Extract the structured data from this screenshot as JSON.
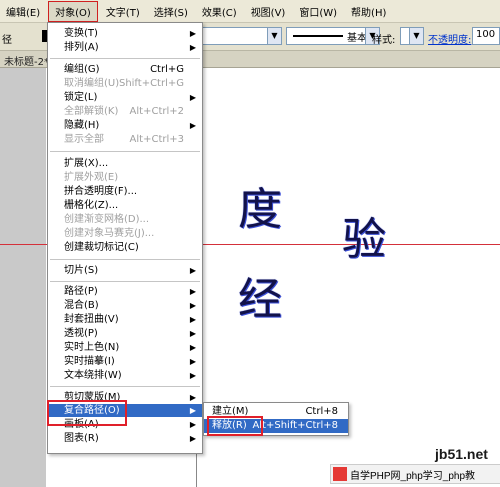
{
  "menubar": {
    "items": [
      "编辑(E)",
      "对象(O)",
      "文字(T)",
      "选择(S)",
      "效果(C)",
      "视图(V)",
      "窗口(W)",
      "帮助(H)"
    ]
  },
  "control_bar": {
    "left_label": "径",
    "stroke_style": "基本",
    "style_label": "样式:",
    "opacity_label": "不透明度:",
    "opacity_value": "100"
  },
  "document_tab": {
    "title": "未标题-2*"
  },
  "canvas": {
    "glyph_du": "度",
    "glyph_yan": "验",
    "glyph_jing": "经"
  },
  "object_menu": {
    "items": [
      {
        "label": "变换(T)",
        "submenu": true
      },
      {
        "label": "排列(A)",
        "submenu": true
      },
      {
        "label": "编组(G)",
        "shortcut": "Ctrl+G"
      },
      {
        "label": "取消编组(U)",
        "shortcut": "Shift+Ctrl+G",
        "disabled": true
      },
      {
        "label": "锁定(L)",
        "submenu": true
      },
      {
        "label": "全部解锁(K)",
        "shortcut": "Alt+Ctrl+2",
        "disabled": true
      },
      {
        "label": "隐藏(H)",
        "submenu": true
      },
      {
        "label": "显示全部",
        "shortcut": "Alt+Ctrl+3",
        "disabled": true
      },
      {
        "label": "扩展(X)..."
      },
      {
        "label": "扩展外观(E)",
        "disabled": true
      },
      {
        "label": "拼合透明度(F)..."
      },
      {
        "label": "栅格化(Z)..."
      },
      {
        "label": "创建渐变网格(D)...",
        "disabled": true
      },
      {
        "label": "创建对象马赛克(J)...",
        "disabled": true
      },
      {
        "label": "创建裁切标记(C)"
      },
      {
        "label": "切片(S)",
        "submenu": true
      },
      {
        "label": "路径(P)",
        "submenu": true
      },
      {
        "label": "混合(B)",
        "submenu": true
      },
      {
        "label": "封套扭曲(V)",
        "submenu": true
      },
      {
        "label": "透视(P)",
        "submenu": true
      },
      {
        "label": "实时上色(N)",
        "submenu": true
      },
      {
        "label": "实时描摹(I)",
        "submenu": true
      },
      {
        "label": "文本绕排(W)",
        "submenu": true
      },
      {
        "label": "剪切蒙版(M)",
        "submenu": true
      },
      {
        "label": "复合路径(O)",
        "submenu": true,
        "highlighted": true
      },
      {
        "label": "画板(A)",
        "submenu": true
      },
      {
        "label": "图表(R)",
        "submenu": true
      }
    ]
  },
  "compound_path_submenu": {
    "items": [
      {
        "label": "建立(M)",
        "shortcut": "Ctrl+8"
      },
      {
        "label": "释放(R)",
        "shortcut": "Alt+Shift+Ctrl+8",
        "highlighted": true
      }
    ]
  },
  "watermark": {
    "site": "jb51.net",
    "caption": "自学PHP网_php学习_php教"
  },
  "colors": {
    "highlight": "#316ac5",
    "annotation_red": "#e0202a",
    "guide_red": "#d4303a"
  }
}
